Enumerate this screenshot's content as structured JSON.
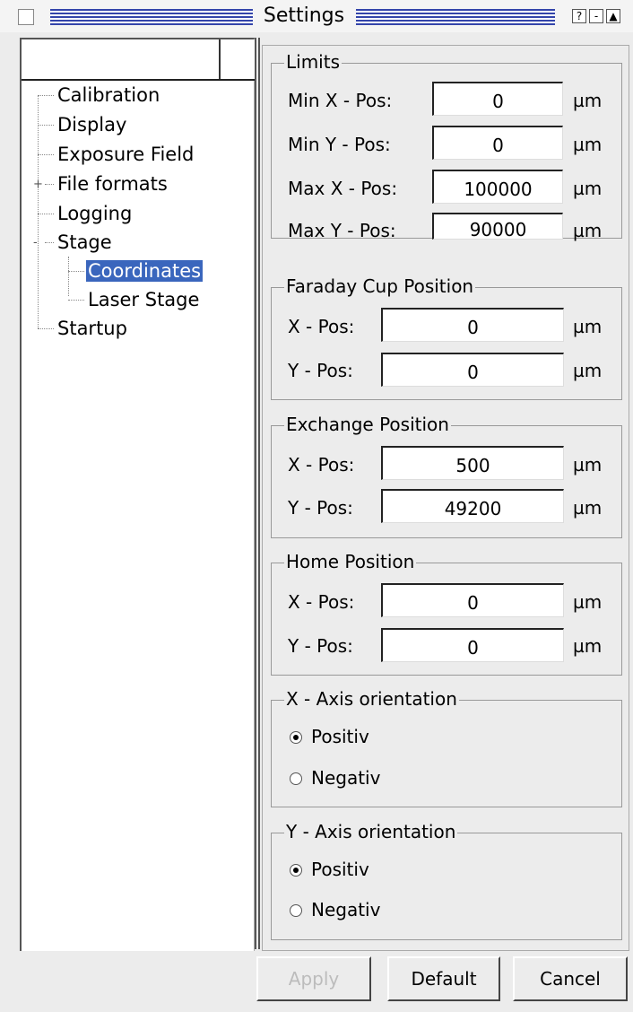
{
  "window": {
    "title": "Settings",
    "help_label": "?",
    "minimize_label": "-",
    "maximize_label": "▲"
  },
  "tree": {
    "items": [
      {
        "label": "Calibration"
      },
      {
        "label": "Display"
      },
      {
        "label": "Exposure Field"
      },
      {
        "label": "File formats",
        "expander": "+"
      },
      {
        "label": "Logging"
      },
      {
        "label": "Stage",
        "expander": "-"
      },
      {
        "label": "Coordinates",
        "selected": true
      },
      {
        "label": "Laser Stage"
      },
      {
        "label": "Startup"
      }
    ]
  },
  "limits": {
    "title": "Limits",
    "rows": [
      {
        "label": "Min X - Pos:",
        "value": "0",
        "unit": "µm"
      },
      {
        "label": "Min Y - Pos:",
        "value": "0",
        "unit": "µm"
      },
      {
        "label": "Max X - Pos:",
        "value": "100000",
        "unit": "µm"
      },
      {
        "label": "Max Y - Pos:",
        "value": "90000",
        "unit": "µm"
      }
    ]
  },
  "faraday": {
    "title": "Faraday Cup Position",
    "rows": [
      {
        "label": "X - Pos:",
        "value": "0",
        "unit": "µm"
      },
      {
        "label": "Y - Pos:",
        "value": "0",
        "unit": "µm"
      }
    ]
  },
  "exchange": {
    "title": "Exchange Position",
    "rows": [
      {
        "label": "X - Pos:",
        "value": "500",
        "unit": "µm"
      },
      {
        "label": "Y - Pos:",
        "value": "49200",
        "unit": "µm"
      }
    ]
  },
  "home": {
    "title": "Home Position",
    "rows": [
      {
        "label": "X - Pos:",
        "value": "0",
        "unit": "µm"
      },
      {
        "label": "Y - Pos:",
        "value": "0",
        "unit": "µm"
      }
    ]
  },
  "x_axis": {
    "title": "X - Axis orientation",
    "positive_label": "Positiv",
    "negative_label": "Negativ",
    "selected": "positive"
  },
  "y_axis": {
    "title": "Y - Axis orientation",
    "positive_label": "Positiv",
    "negative_label": "Negativ",
    "selected": "positive"
  },
  "buttons": {
    "apply_label": "Apply",
    "default_label": "Default",
    "cancel_label": "Cancel"
  }
}
